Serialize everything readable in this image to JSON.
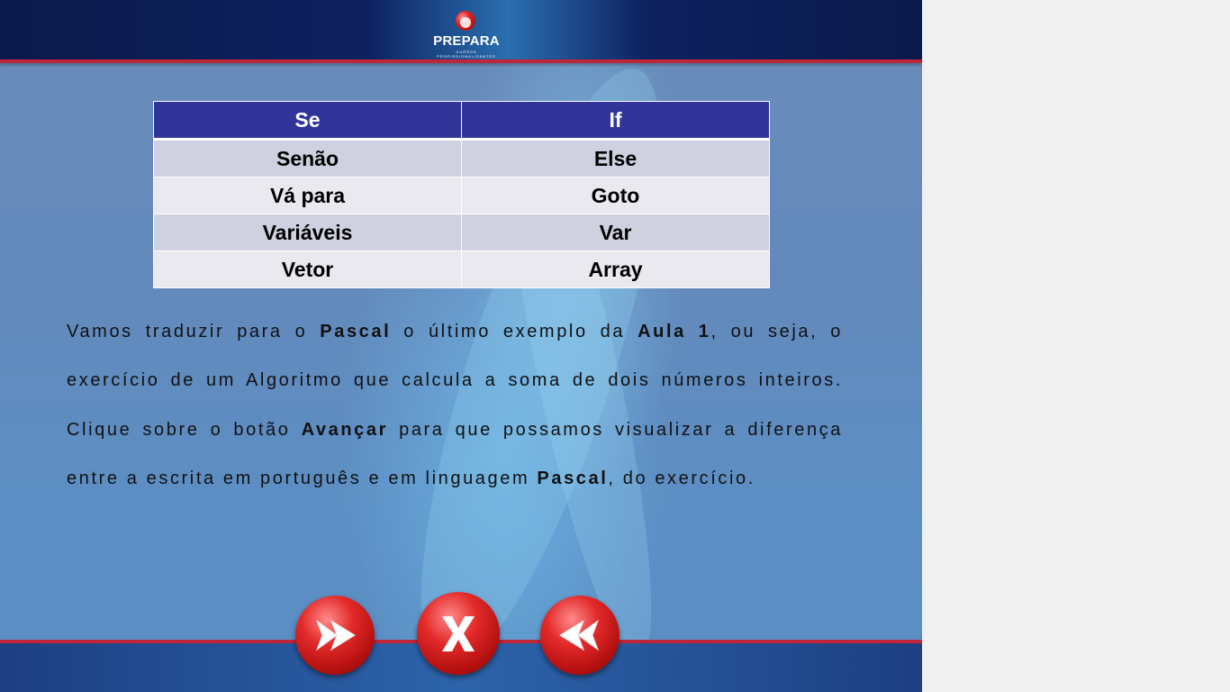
{
  "header": {
    "logo_text": "PREPARA",
    "logo_subtext": "CURSOS PROFISSIONALIZANTES"
  },
  "table": {
    "header": [
      "Se",
      "If"
    ],
    "rows": [
      [
        "Senão",
        "Else"
      ],
      [
        "Vá para",
        "Goto"
      ],
      [
        "Variáveis",
        "Var"
      ],
      [
        "Vetor",
        "Array"
      ]
    ]
  },
  "paragraph": {
    "t1": "Vamos traduzir para o ",
    "b1": "Pascal",
    "t2": " o último exemplo da ",
    "b2": "Aula 1",
    "t3": ", ou seja, o exercício de um Algoritmo que calcula a soma de dois números inteiros. Clique sobre o botão ",
    "b3": "Avançar",
    "t4": " para que possamos visualizar a diferença entre a escrita em português e em linguagem ",
    "b4": "Pascal",
    "t5": ", do exercício."
  },
  "buttons": {
    "next_icon": "forward-arrow-icon",
    "close_icon": "close-x-icon",
    "prev_icon": "back-arrow-icon"
  },
  "colors": {
    "table_header_bg": "#31359a",
    "accent_red": "#c0263a",
    "button_red": "#e32a2a"
  }
}
